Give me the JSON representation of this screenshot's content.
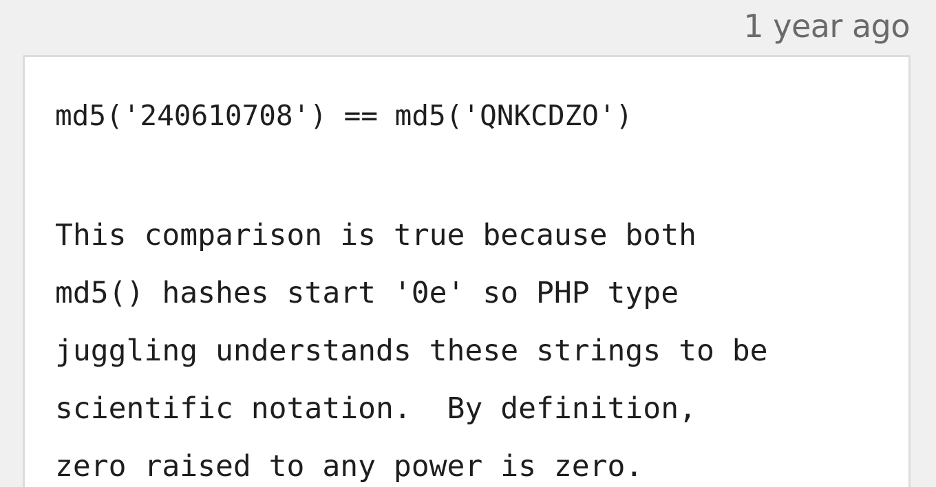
{
  "post": {
    "timestamp": "1 year ago"
  },
  "code": {
    "lines": [
      "md5('240610708') == md5('QNKCDZO')",
      "This comparison is true because both",
      "md5() hashes start '0e' so PHP type",
      "juggling understands these strings to be",
      "scientific notation.  By definition,",
      "zero raised to any power is zero."
    ]
  }
}
